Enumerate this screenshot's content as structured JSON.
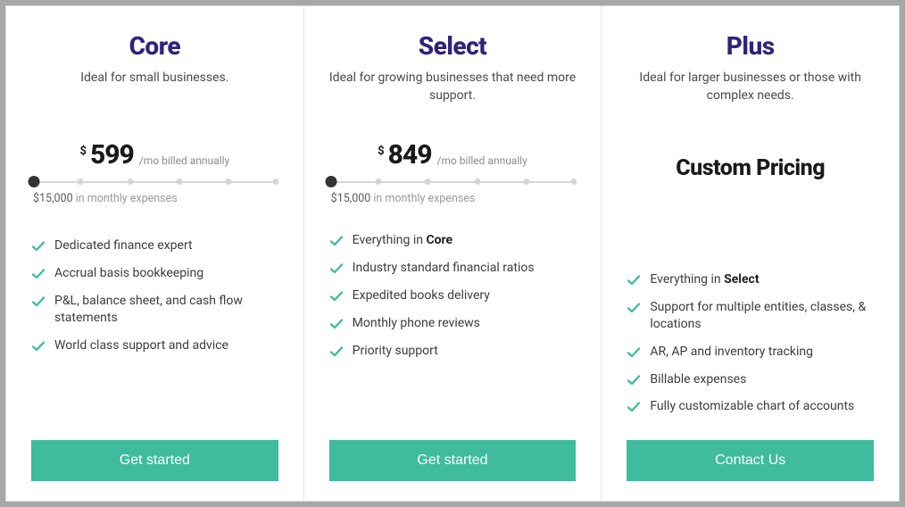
{
  "plans": [
    {
      "title": "Core",
      "subtitle": "Ideal for small businesses.",
      "price": {
        "currency": "$",
        "amount": "599",
        "suffix": "/mo billed annually"
      },
      "expense_caption_amount": "$15,000",
      "expense_caption_rest": " in monthly expenses",
      "features": [
        "Dedicated finance expert",
        "Accrual basis bookkeeping",
        "P&L, balance sheet, and cash flow statements",
        "World class support and advice"
      ],
      "cta": "Get started"
    },
    {
      "title": "Select",
      "subtitle": "Ideal for growing businesses that need more support.",
      "price": {
        "currency": "$",
        "amount": "849",
        "suffix": "/mo billed annually"
      },
      "expense_caption_amount": "$15,000",
      "expense_caption_rest": " in monthly expenses",
      "features_prefix": "Everything in ",
      "features_prefix_bold": "Core",
      "features": [
        "Industry standard financial ratios",
        "Expedited books delivery",
        "Monthly phone reviews",
        "Priority support"
      ],
      "cta": "Get started"
    },
    {
      "title": "Plus",
      "subtitle": "Ideal for larger businesses or those with complex needs.",
      "custom_price": "Custom Pricing",
      "features_prefix": "Everything in ",
      "features_prefix_bold": "Select",
      "features": [
        "Support for multiple entities, classes, & locations",
        "AR, AP and inventory tracking",
        "Billable expenses",
        "Fully customizable chart of accounts"
      ],
      "cta": "Contact Us"
    }
  ],
  "colors": {
    "brand_title": "#2f237a",
    "accent": "#3fbb9d"
  }
}
